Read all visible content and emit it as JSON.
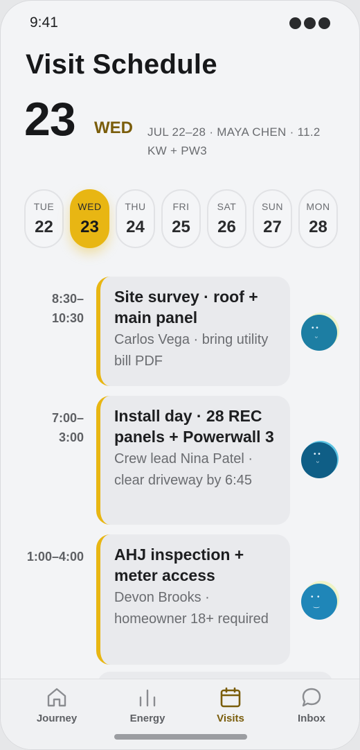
{
  "status": {
    "time": "9:41"
  },
  "header": {
    "title": "Visit Schedule",
    "date_number": "23",
    "date_weekday": "WED",
    "meta": "JUL 22–28 · MAYA CHEN · 11.2 KW + PW3"
  },
  "week": [
    {
      "name": "TUE",
      "num": "22",
      "active": false
    },
    {
      "name": "WED",
      "num": "23",
      "active": true
    },
    {
      "name": "THU",
      "num": "24",
      "active": false
    },
    {
      "name": "FRI",
      "num": "25",
      "active": false
    },
    {
      "name": "SAT",
      "num": "26",
      "active": false
    },
    {
      "name": "SUN",
      "num": "27",
      "active": false
    },
    {
      "name": "MON",
      "num": "28",
      "active": false
    }
  ],
  "visits": [
    {
      "time": "8:30–\n10:30",
      "title": "Site survey · roof + main panel",
      "subtitle": "Carlos Vega · bring utility bill PDF"
    },
    {
      "time": "7:00–\n3:00",
      "title": "Install day · 28 REC panels + Powerwall 3",
      "subtitle": "Crew lead Nina Patel · clear driveway by 6:45"
    },
    {
      "time": "1:00–4:00",
      "title": "AHJ inspection + meter access",
      "subtitle": "Devon Brooks · homeowner 18+ required"
    }
  ],
  "tabs": [
    {
      "label": "Journey",
      "icon": "home-icon",
      "active": false
    },
    {
      "label": "Energy",
      "icon": "bars-icon",
      "active": false
    },
    {
      "label": "Visits",
      "icon": "calendar-icon",
      "active": true
    },
    {
      "label": "Inbox",
      "icon": "chat-bubble-icon",
      "active": false
    }
  ],
  "colors": {
    "accent": "#e8b613",
    "accent_text": "#7a5d0b",
    "background": "#f3f4f6",
    "card": "#e9eaed"
  }
}
